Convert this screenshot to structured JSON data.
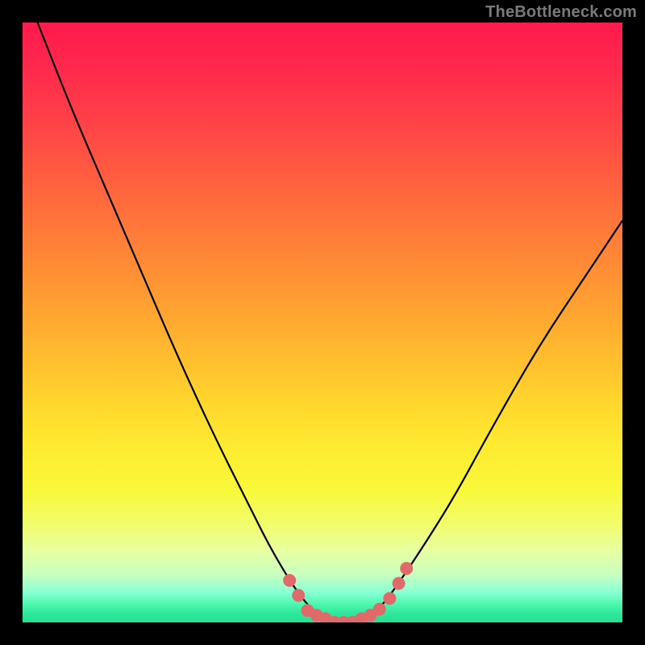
{
  "watermark": "TheBottleneck.com",
  "chart_data": {
    "type": "line",
    "title": "",
    "xlabel": "",
    "ylabel": "",
    "xlim": [
      0,
      1
    ],
    "ylim": [
      0,
      1
    ],
    "note": "Axes are unlabeled; x and y are normalized 0–1 fractions of the plot area. Curve traces a bottleneck profile with minimum at x≈0.54.",
    "series": [
      {
        "name": "bottleneck-curve",
        "x": [
          0.025,
          0.08,
          0.14,
          0.2,
          0.26,
          0.32,
          0.37,
          0.41,
          0.445,
          0.47,
          0.49,
          0.52,
          0.56,
          0.585,
          0.605,
          0.63,
          0.67,
          0.72,
          0.78,
          0.86,
          0.94,
          1.0
        ],
        "y": [
          1.0,
          0.86,
          0.72,
          0.58,
          0.44,
          0.31,
          0.21,
          0.13,
          0.07,
          0.035,
          0.015,
          0.0,
          0.0,
          0.015,
          0.035,
          0.07,
          0.13,
          0.21,
          0.32,
          0.46,
          0.58,
          0.67
        ]
      }
    ],
    "markers": {
      "name": "highlight-markers",
      "color": "#e06a6a",
      "points": [
        {
          "x": 0.445,
          "y": 0.07
        },
        {
          "x": 0.46,
          "y": 0.045
        },
        {
          "x": 0.475,
          "y": 0.02
        },
        {
          "x": 0.49,
          "y": 0.012
        },
        {
          "x": 0.505,
          "y": 0.006
        },
        {
          "x": 0.52,
          "y": 0.0
        },
        {
          "x": 0.535,
          "y": 0.0
        },
        {
          "x": 0.55,
          "y": 0.0
        },
        {
          "x": 0.565,
          "y": 0.006
        },
        {
          "x": 0.58,
          "y": 0.012
        },
        {
          "x": 0.595,
          "y": 0.022
        },
        {
          "x": 0.612,
          "y": 0.04
        },
        {
          "x": 0.627,
          "y": 0.065
        },
        {
          "x": 0.64,
          "y": 0.09
        }
      ]
    }
  }
}
